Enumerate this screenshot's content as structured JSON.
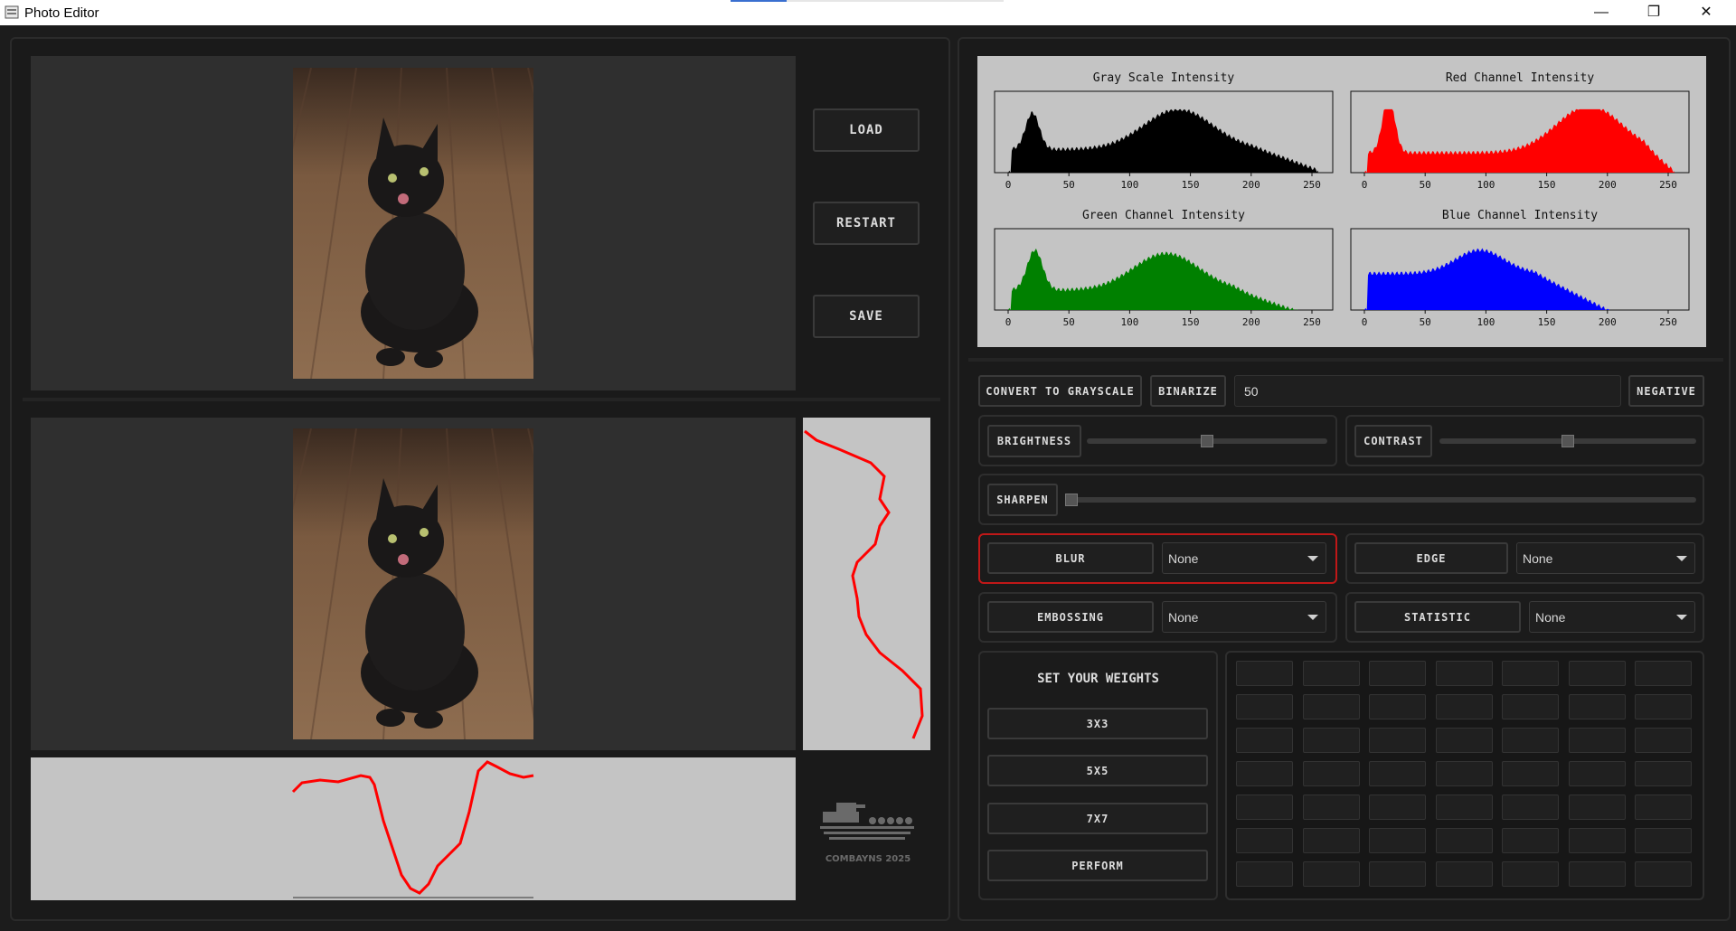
{
  "window": {
    "title": "Photo Editor",
    "minimize": "—",
    "maximize": "❐",
    "close": "✕"
  },
  "buttons": {
    "load": "LOAD",
    "restart": "RESTART",
    "save": "SAVE"
  },
  "histograms": [
    {
      "title": "Gray Scale Intensity",
      "color": "#000000",
      "ticks": [
        "0",
        "50",
        "100",
        "150",
        "200",
        "250"
      ]
    },
    {
      "title": "Red Channel Intensity",
      "color": "#ff0000",
      "ticks": [
        "0",
        "50",
        "100",
        "150",
        "200",
        "250"
      ]
    },
    {
      "title": "Green Channel Intensity",
      "color": "#008000",
      "ticks": [
        "0",
        "50",
        "100",
        "150",
        "200",
        "250"
      ]
    },
    {
      "title": "Blue Channel Intensity",
      "color": "#0000ff",
      "ticks": [
        "0",
        "50",
        "100",
        "150",
        "200",
        "250"
      ]
    }
  ],
  "controls": {
    "grayscale": "CONVERT TO GRAYSCALE",
    "binarize": "BINARIZE",
    "binarize_value": "50",
    "negative": "NEGATIVE",
    "brightness": "BRIGHTNESS",
    "brightness_level": 0.5,
    "contrast": "CONTRAST",
    "contrast_level": 0.5,
    "sharpen": "SHARPEN",
    "sharpen_level": 0.0,
    "blur": "BLUR",
    "blur_value": "None",
    "edge": "EDGE",
    "edge_value": "None",
    "embossing": "EMBOSSING",
    "embossing_value": "None",
    "statistic": "STATISTIC",
    "statistic_value": "None"
  },
  "weights": {
    "heading": "SET YOUR WEIGHTS",
    "b3": "3X3",
    "b5": "5X5",
    "b7": "7X7",
    "perform": "PERFORM"
  },
  "logo": {
    "caption": "COMBAYNS 2025"
  },
  "colors": {
    "accent_red": "#ff0000",
    "blur_border": "#c01818"
  }
}
